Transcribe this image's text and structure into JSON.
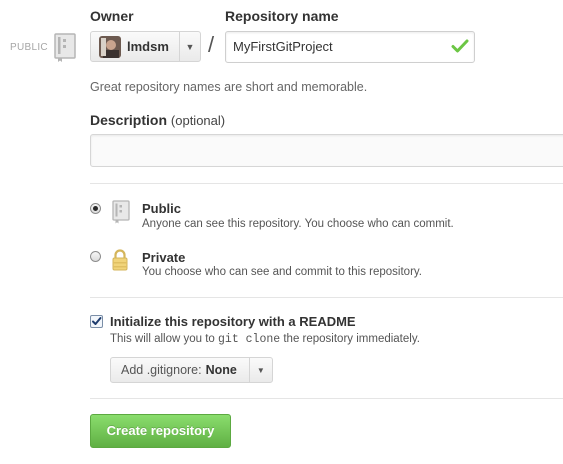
{
  "visibility_tag": "PUBLIC",
  "owner": {
    "label": "Owner",
    "selected": "lmdsm",
    "avatar_icon": "user-avatar",
    "caret_icon": "chevron-down-icon"
  },
  "separator": "/",
  "repository_name": {
    "label": "Repository name",
    "value": "MyFirstGitProject",
    "status_icon": "check-icon",
    "status_color": "#6cc644",
    "hint": "Great repository names are short and memorable."
  },
  "description": {
    "label": "Description",
    "optional": "(optional)",
    "value": ""
  },
  "visibility": {
    "selected": "public",
    "options": [
      {
        "id": "public",
        "title": "Public",
        "description": "Anyone can see this repository. You choose who can commit.",
        "icon": "repo-book-icon"
      },
      {
        "id": "private",
        "title": "Private",
        "description": "You choose who can see and commit to this repository.",
        "icon": "lock-icon"
      }
    ]
  },
  "readme": {
    "checked": true,
    "title": "Initialize this repository with a README",
    "desc_before": "This will allow you to",
    "desc_code": "git clone",
    "desc_after": "the repository immediately."
  },
  "gitignore": {
    "label": "Add .gitignore:",
    "value": "None",
    "caret_icon": "chevron-down-icon"
  },
  "submit": {
    "label": "Create repository",
    "color": "#6cc644"
  }
}
